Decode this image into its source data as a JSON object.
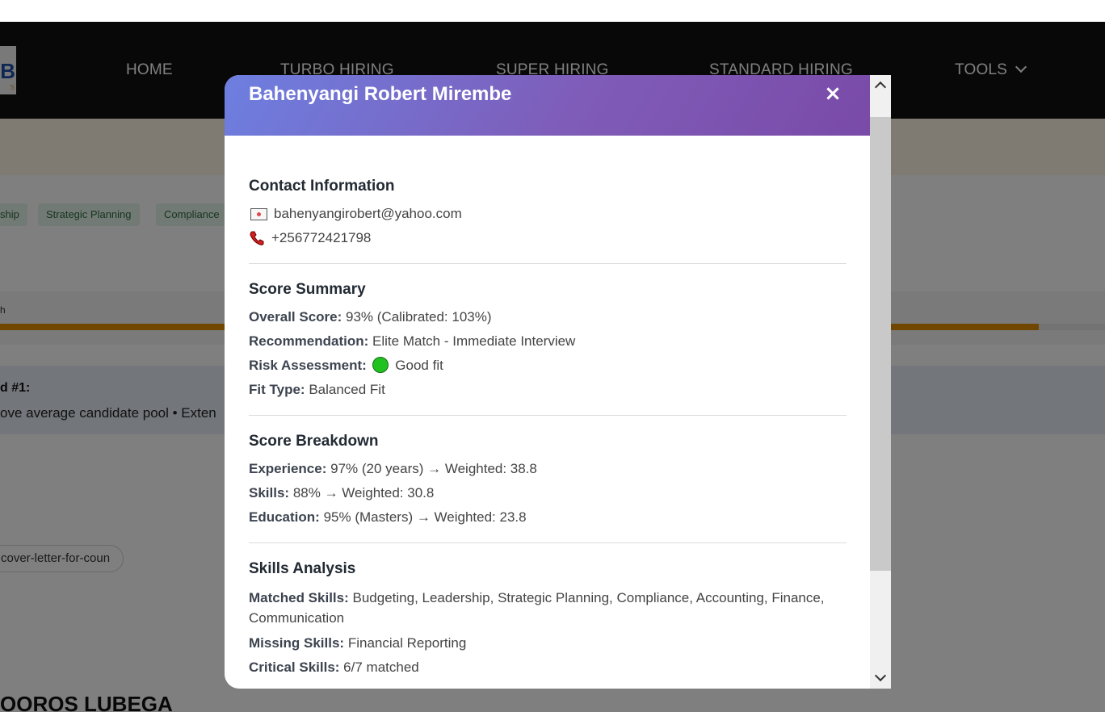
{
  "nav": {
    "logo_letter": "B",
    "logo_sub": "S",
    "items": [
      "HOME",
      "TURBO HIRING",
      "SUPER HIRING",
      "STANDARD HIRING",
      "TOOLS"
    ]
  },
  "background": {
    "tags": [
      "ship",
      "Strategic Planning",
      "Compliance"
    ],
    "strip_text": "h",
    "progress_fraction": 0.94,
    "notice_title": "d #1:",
    "notice_text": "ove average candidate pool • Exten",
    "file_chip": "cover-letter-for-coun",
    "candidate_name": "OOROS LUBEGA"
  },
  "modal": {
    "title": "Bahenyangi Robert Mirembe",
    "close_label": "×",
    "contact": {
      "heading": "Contact Information",
      "email": "bahenyangirobert@yahoo.com",
      "phone": "+256772421798"
    },
    "score_summary": {
      "heading": "Score Summary",
      "overall_label": "Overall Score:",
      "overall_value": "93% (Calibrated: 103%)",
      "recommendation_label": "Recommendation:",
      "recommendation_value": "Elite Match - Immediate Interview",
      "risk_label": "Risk Assessment:",
      "risk_value": "Good fit",
      "fit_label": "Fit Type:",
      "fit_value": "Balanced Fit"
    },
    "score_breakdown": {
      "heading": "Score Breakdown",
      "experience_label": "Experience:",
      "experience_value": "97% (20 years) → Weighted: 38.8",
      "skills_label": "Skills:",
      "skills_value": "88% → Weighted: 30.8",
      "education_label": "Education:",
      "education_value": "95% (Masters) → Weighted: 23.8"
    },
    "skills_analysis": {
      "heading": "Skills Analysis",
      "matched_label": "Matched Skills:",
      "matched_value": "Budgeting, Leadership, Strategic Planning, Compliance, Accounting, Finance, Communication",
      "missing_label": "Missing Skills:",
      "missing_value": "Financial Reporting",
      "critical_label": "Critical Skills:",
      "critical_value": "6/7 matched"
    }
  },
  "colors": {
    "header_gradient_start": "#6d7fe0",
    "header_gradient_end": "#7a4aa8",
    "risk_good": "#1fc21f",
    "progress": "#e08c00"
  }
}
